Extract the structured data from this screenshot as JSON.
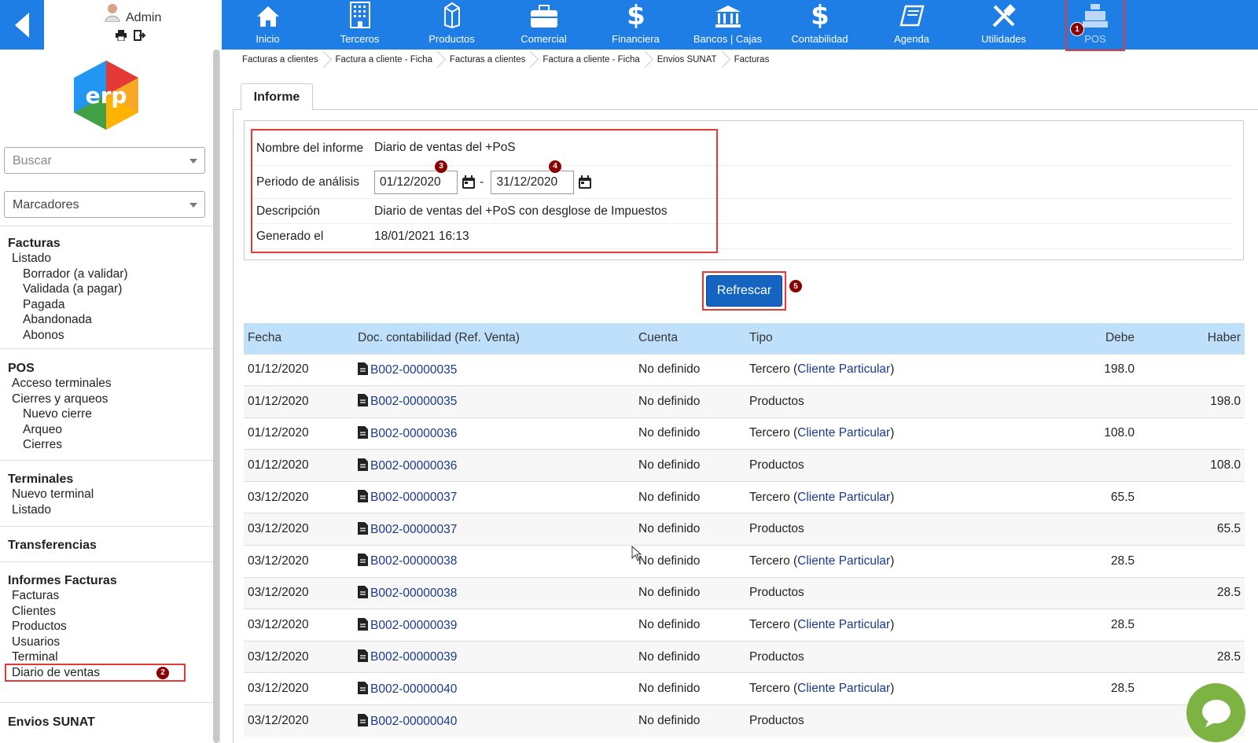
{
  "header": {
    "user_name": "Admin",
    "nav": [
      {
        "label": "Inicio",
        "icon": "home-icon"
      },
      {
        "label": "Terceros",
        "icon": "building-icon"
      },
      {
        "label": "Productos",
        "icon": "box-icon"
      },
      {
        "label": "Comercial",
        "icon": "briefcase-icon"
      },
      {
        "label": "Financiera",
        "icon": "dollar-icon"
      },
      {
        "label": "Bancos | Cajas",
        "icon": "bank-icon"
      },
      {
        "label": "Contabilidad",
        "icon": "dollar-icon"
      },
      {
        "label": "Agenda",
        "icon": "book-icon"
      },
      {
        "label": "Utilidades",
        "icon": "tools-icon"
      },
      {
        "label": "POS",
        "icon": "cash-register-icon"
      }
    ]
  },
  "sidebar": {
    "search_placeholder": "Buscar",
    "bookmarks_placeholder": "Marcadores",
    "sections": {
      "facturas": {
        "title": "Facturas",
        "l1": "Listado",
        "items": [
          "Borrador (a validar)",
          "Validada (a pagar)",
          "Pagada",
          "Abandonada",
          "Abonos"
        ]
      },
      "pos": {
        "title": "POS",
        "l1a": "Acceso terminales",
        "l1b": "Cierres y arqueos",
        "items": [
          "Nuevo cierre",
          "Arqueo",
          "Cierres"
        ]
      },
      "terminales": {
        "title": "Terminales",
        "items": [
          "Nuevo terminal",
          "Listado"
        ]
      },
      "transferencias": {
        "title": "Transferencias"
      },
      "informes": {
        "title": "Informes Facturas",
        "items": [
          "Facturas",
          "Clientes",
          "Productos",
          "Usuarios",
          "Terminal",
          "Diario de ventas"
        ]
      },
      "envios": {
        "title": "Envios SUNAT"
      }
    }
  },
  "breadcrumbs": [
    "Facturas a clientes",
    "Factura a cliente - Ficha",
    "Facturas a clientes",
    "Factura a cliente - Ficha",
    "Envios SUNAT",
    "Facturas"
  ],
  "tab_label": "Informe",
  "report": {
    "name_label": "Nombre del informe",
    "name_value": "Diario de ventas del +PoS",
    "period_label": "Periodo de análisis",
    "date_from": "01/12/2020",
    "date_to": "31/12/2020",
    "separator": "-",
    "desc_label": "Descripción",
    "desc_value": "Diario de ventas del +PoS con desglose de Impuestos",
    "generated_label": "Generado el",
    "generated_value": "18/01/2021 16:13"
  },
  "refresh_label": "Refrescar",
  "badges": [
    "1",
    "2",
    "3",
    "4",
    "5"
  ],
  "table": {
    "headers": {
      "fecha": "Fecha",
      "doc": "Doc. contabilidad (Ref. Venta)",
      "cuenta": "Cuenta",
      "tipo": "Tipo",
      "debe": "Debe",
      "haber": "Haber"
    },
    "rows": [
      {
        "fecha": "01/12/2020",
        "doc": "B002-00000035",
        "cuenta": "No definido",
        "tipo": "Tercero (",
        "cliente": "Cliente Particular",
        "tipo_end": ")",
        "debe": "198.0",
        "haber": ""
      },
      {
        "fecha": "01/12/2020",
        "doc": "B002-00000035",
        "cuenta": "No definido",
        "tipo": "Productos",
        "cliente": "",
        "tipo_end": "",
        "debe": "",
        "haber": "198.0"
      },
      {
        "fecha": "01/12/2020",
        "doc": "B002-00000036",
        "cuenta": "No definido",
        "tipo": "Tercero (",
        "cliente": "Cliente Particular",
        "tipo_end": ")",
        "debe": "108.0",
        "haber": ""
      },
      {
        "fecha": "01/12/2020",
        "doc": "B002-00000036",
        "cuenta": "No definido",
        "tipo": "Productos",
        "cliente": "",
        "tipo_end": "",
        "debe": "",
        "haber": "108.0"
      },
      {
        "fecha": "03/12/2020",
        "doc": "B002-00000037",
        "cuenta": "No definido",
        "tipo": "Tercero (",
        "cliente": "Cliente Particular",
        "tipo_end": ")",
        "debe": "65.5",
        "haber": ""
      },
      {
        "fecha": "03/12/2020",
        "doc": "B002-00000037",
        "cuenta": "No definido",
        "tipo": "Productos",
        "cliente": "",
        "tipo_end": "",
        "debe": "",
        "haber": "65.5"
      },
      {
        "fecha": "03/12/2020",
        "doc": "B002-00000038",
        "cuenta": "No definido",
        "tipo": "Tercero (",
        "cliente": "Cliente Particular",
        "tipo_end": ")",
        "debe": "28.5",
        "haber": ""
      },
      {
        "fecha": "03/12/2020",
        "doc": "B002-00000038",
        "cuenta": "No definido",
        "tipo": "Productos",
        "cliente": "",
        "tipo_end": "",
        "debe": "",
        "haber": "28.5"
      },
      {
        "fecha": "03/12/2020",
        "doc": "B002-00000039",
        "cuenta": "No definido",
        "tipo": "Tercero (",
        "cliente": "Cliente Particular",
        "tipo_end": ")",
        "debe": "28.5",
        "haber": ""
      },
      {
        "fecha": "03/12/2020",
        "doc": "B002-00000039",
        "cuenta": "No definido",
        "tipo": "Productos",
        "cliente": "",
        "tipo_end": "",
        "debe": "",
        "haber": "28.5"
      },
      {
        "fecha": "03/12/2020",
        "doc": "B002-00000040",
        "cuenta": "No definido",
        "tipo": "Tercero (",
        "cliente": "Cliente Particular",
        "tipo_end": ")",
        "debe": "28.5",
        "haber": ""
      },
      {
        "fecha": "03/12/2020",
        "doc": "B002-00000040",
        "cuenta": "No definido",
        "tipo": "Productos",
        "cliente": "",
        "tipo_end": "",
        "debe": "",
        "haber": ""
      }
    ]
  },
  "colors": {
    "topbar": "#1e7ee6",
    "header_row": "#bfe0fb",
    "highlight": "#e53935",
    "badge": "#8b0000",
    "chat": "#7cb342"
  }
}
